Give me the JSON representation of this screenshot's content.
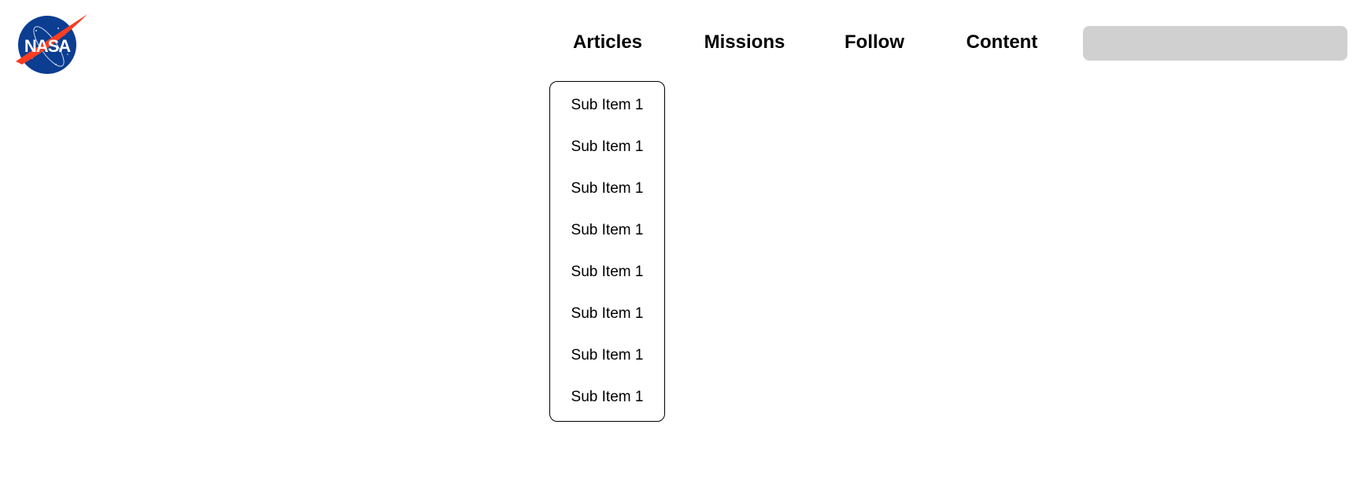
{
  "logo": {
    "alt": "NASA",
    "colors": {
      "blue": "#0b3d91",
      "red": "#fc3d21"
    }
  },
  "nav": {
    "items": [
      {
        "label": "Articles"
      },
      {
        "label": "Missions"
      },
      {
        "label": "Follow"
      },
      {
        "label": "Content"
      }
    ]
  },
  "search": {
    "value": "",
    "placeholder": ""
  },
  "dropdown": {
    "items": [
      "Sub Item 1",
      "Sub Item 1",
      "Sub Item 1",
      "Sub Item 1",
      "Sub Item 1",
      "Sub Item 1",
      "Sub Item 1",
      "Sub Item 1"
    ]
  }
}
